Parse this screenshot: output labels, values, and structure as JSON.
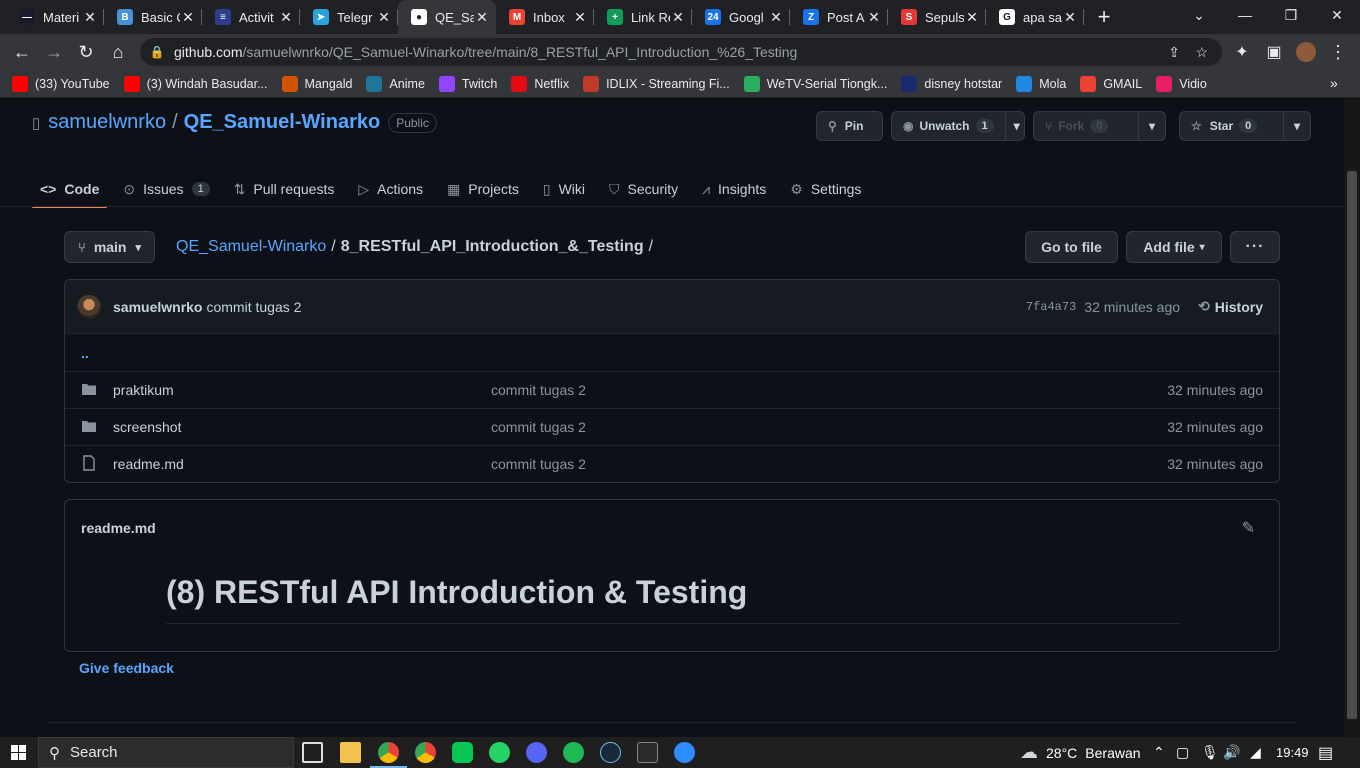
{
  "browser": {
    "tabs": [
      {
        "title": "Materi",
        "color": "#1a1a2e",
        "glyph": "—"
      },
      {
        "title": "Basic C",
        "color": "#4a90d9",
        "glyph": "B"
      },
      {
        "title": "Activit",
        "color": "#2c3e8c",
        "glyph": "≡"
      },
      {
        "title": "Telegr",
        "color": "#2aa3dd",
        "glyph": "➤"
      },
      {
        "title": "QE_Sa",
        "color": "#ffffff",
        "glyph": "●"
      },
      {
        "title": "Inbox",
        "color": "#ea4335",
        "glyph": "M"
      },
      {
        "title": "Link Re",
        "color": "#0f9d58",
        "glyph": "+"
      },
      {
        "title": "Googl",
        "color": "#1a73e8",
        "glyph": "24"
      },
      {
        "title": "Post A",
        "color": "#1a73e8",
        "glyph": "Z"
      },
      {
        "title": "Sepuls",
        "color": "#e53935",
        "glyph": "S"
      },
      {
        "title": "apa sa",
        "color": "#ffffff",
        "glyph": "G"
      }
    ],
    "url_host": "github.com",
    "url_path": "/samuelwnrko/QE_Samuel-Winarko/tree/main/8_RESTful_API_Introduction_%26_Testing",
    "bookmarks": [
      {
        "label": "(33) YouTube",
        "color": "#ff0000"
      },
      {
        "label": "(3) Windah Basudar...",
        "color": "#ff0000"
      },
      {
        "label": "Mangald",
        "color": "#d35400"
      },
      {
        "label": "Anime",
        "color": "#21759b"
      },
      {
        "label": "Twitch",
        "color": "#9146ff"
      },
      {
        "label": "Netflix",
        "color": "#e50914"
      },
      {
        "label": "IDLIX - Streaming Fi...",
        "color": "#c0392b"
      },
      {
        "label": "WeTV-Serial Tiongk...",
        "color": "#27ae60"
      },
      {
        "label": "disney hotstar",
        "color": "#1a2b6d"
      },
      {
        "label": "Mola",
        "color": "#1e88e5"
      },
      {
        "label": "GMAIL",
        "color": "#ea4335"
      },
      {
        "label": "Vidio",
        "color": "#e91e63"
      }
    ]
  },
  "repo": {
    "owner": "samuelwnrko",
    "name": "QE_Samuel-Winarko",
    "visibility": "Public",
    "pin": "Pin",
    "unwatch": "Unwatch",
    "watch_count": "1",
    "fork": "Fork",
    "fork_count": "0",
    "star": "Star",
    "star_count": "0"
  },
  "nav": [
    {
      "label": "Code",
      "icon": "<>",
      "name": "code"
    },
    {
      "label": "Issues",
      "icon": "⊙",
      "name": "issues",
      "count": "1"
    },
    {
      "label": "Pull requests",
      "icon": "⇅",
      "name": "pull-requests"
    },
    {
      "label": "Actions",
      "icon": "▷",
      "name": "actions"
    },
    {
      "label": "Projects",
      "icon": "▦",
      "name": "projects"
    },
    {
      "label": "Wiki",
      "icon": "▯",
      "name": "wiki"
    },
    {
      "label": "Security",
      "icon": "⛉",
      "name": "security"
    },
    {
      "label": "Insights",
      "icon": "⩘",
      "name": "insights"
    },
    {
      "label": "Settings",
      "icon": "⚙",
      "name": "settings"
    }
  ],
  "path": {
    "branch": "main",
    "repo_link": "QE_Samuel-Winarko",
    "folder": "8_RESTful_API_Introduction_&_Testing",
    "go_to_file": "Go to file",
    "add_file": "Add file"
  },
  "commit": {
    "author": "samuelwnrko",
    "message": "commit tugas 2",
    "sha": "7fa4a73",
    "time": "32 minutes ago",
    "history": "History"
  },
  "files": [
    {
      "name": "..",
      "type": "up",
      "message": "",
      "age": ""
    },
    {
      "name": "praktikum",
      "type": "folder",
      "message": "commit tugas 2",
      "age": "32 minutes ago"
    },
    {
      "name": "screenshot",
      "type": "folder",
      "message": "commit tugas 2",
      "age": "32 minutes ago"
    },
    {
      "name": "readme.md",
      "type": "file",
      "message": "commit tugas 2",
      "age": "32 minutes ago"
    }
  ],
  "readme": {
    "filename": "readme.md",
    "heading": "(8) RESTful API Introduction & Testing"
  },
  "feedback": "Give feedback",
  "taskbar": {
    "search": "Search",
    "weather_temp": "28°C",
    "weather_desc": "Berawan",
    "clock": "19:49"
  }
}
